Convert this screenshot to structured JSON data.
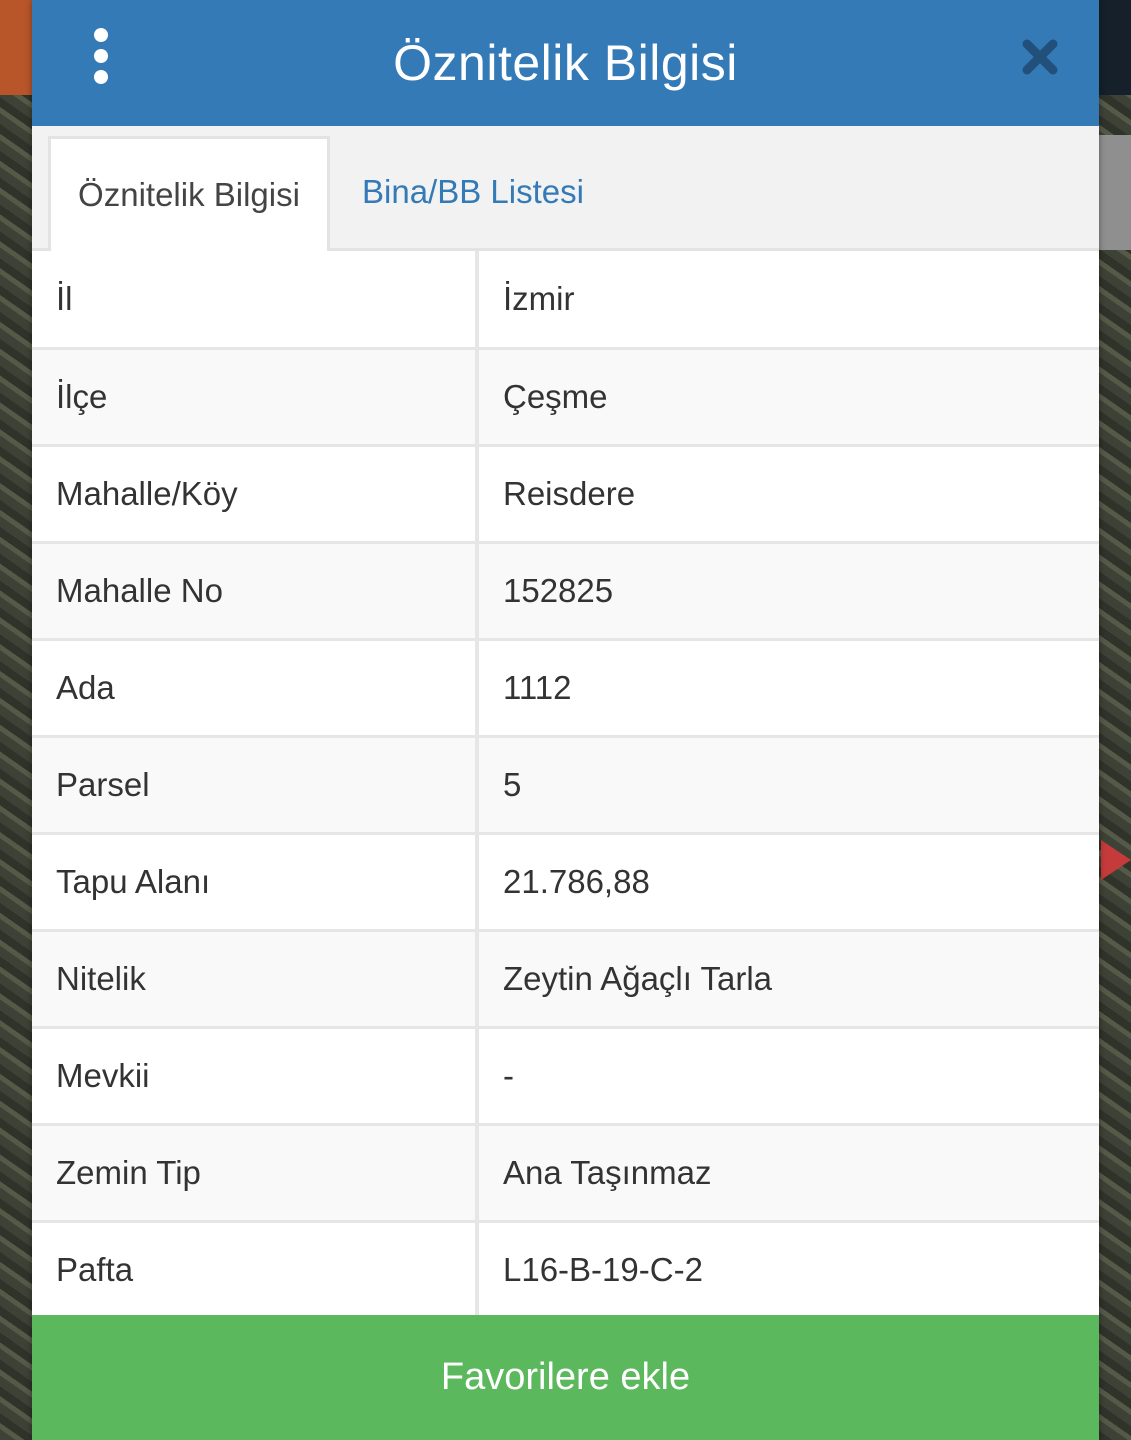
{
  "header": {
    "title": "Öznitelik Bilgisi"
  },
  "tabs": [
    {
      "label": "Öznitelik Bilgisi",
      "active": true
    },
    {
      "label": "Bina/BB Listesi",
      "active": false
    }
  ],
  "attributes": [
    {
      "key": "İl",
      "value": "İzmir"
    },
    {
      "key": "İlçe",
      "value": "Çeşme"
    },
    {
      "key": "Mahalle/Köy",
      "value": "Reisdere"
    },
    {
      "key": "Mahalle No",
      "value": "152825"
    },
    {
      "key": "Ada",
      "value": "1112"
    },
    {
      "key": "Parsel",
      "value": "5"
    },
    {
      "key": "Tapu Alanı",
      "value": "21.786,88"
    },
    {
      "key": "Nitelik",
      "value": "Zeytin Ağaçlı Tarla"
    },
    {
      "key": "Mevkii",
      "value": "-"
    },
    {
      "key": "Zemin Tip",
      "value": "Ana Taşınmaz"
    },
    {
      "key": "Pafta",
      "value": "L16-B-19-C-2"
    }
  ],
  "footer": {
    "favorite_label": "Favorilere ekle"
  },
  "colors": {
    "header": "#337ab7",
    "tab_link": "#337ab7",
    "favorite_button": "#5cb85c"
  },
  "icons": {
    "menu": "vertical-ellipsis-icon",
    "close": "close-icon"
  }
}
